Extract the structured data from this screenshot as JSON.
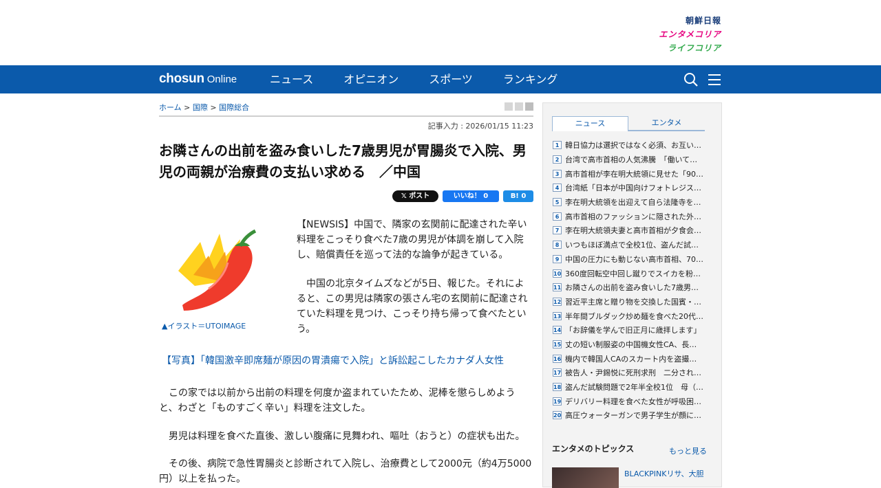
{
  "brand_links": [
    "朝鮮日報",
    "エンタメコリア",
    "ライフコリア"
  ],
  "nav": {
    "logo_bold": "chosun",
    "logo_light": "Online",
    "items": [
      "ニュース",
      "オピニオン",
      "スポーツ",
      "ランキング"
    ],
    "icons": [
      "search-icon",
      "menu-icon"
    ]
  },
  "breadcrumb": {
    "home": "ホーム",
    "sep": " > ",
    "cat1": "国際",
    "cat2": "国際総合"
  },
  "article": {
    "date": "記事入力 : 2026/01/15 11:23",
    "headline": "お隣さんの出前を盗み食いした7歳男児が胃腸炎で入院、男児の両親が治療費の支払い求める　／中国",
    "share": {
      "x": "𝕏 ポスト",
      "fb": "いいね！ 0",
      "hb": "B! 0"
    },
    "caption": "▲イラスト＝UTOIMAGE",
    "p1": "【NEWSIS】中国で、隣家の玄関前に配達された辛い料理をこっそり食べた7歳の男児が体調を崩して入院し、賠償責任を巡って法的な論争が起きている。",
    "p2": "　中国の北京タイムズなどが5日、報じた。それによると、この男児は隣家の張さん宅の玄関前に配達されていた料理を見つけ、こっそり持ち帰って食べたという。",
    "related": "【写真】「韓国激辛即席麺が原因の胃潰瘍で入院」と訴訟起こしたカナダ人女性",
    "p3": "　この家では以前から出前の料理を何度か盗まれていたため、泥棒を懲らしめようと、わざと「ものすごく辛い」料理を注文した。",
    "p4": "　男児は料理を食べた直後、激しい腹痛に見舞われ、嘔吐（おうと）の症状も出た。",
    "p5": "　その後、病院で急性胃腸炎と診断されて入院し、治療費として2000元（約4万5000円）以上を払った。"
  },
  "sidebar": {
    "tabs": [
      "ニュース",
      "エンタメ"
    ],
    "ranking": [
      "韓日協力は選択ではなく必須、お互い…",
      "台湾で高市首相の人気沸騰　「働いて…",
      "高市首相が李在明大統領に見せた「90…",
      "台湾紙「日本が中国向けフォトレジス…",
      "李在明大統領を出迎えて自ら法隆寺を…",
      "高市首相のファッションに隠された外…",
      "李在明大統領夫妻と高市首相が夕食会…",
      "いつもほぼ満点で全校1位、盗んだ試…",
      "中国の圧力にも動じない高市首相、70…",
      "360度回転空中回し蹴りでスイカを粉…",
      "お隣さんの出前を盗み食いした7歳男…",
      "習近平主席と贈り物を交換した国賓・…",
      "半年間ブルダック炒め麺を食べた20代…",
      "「お辞儀を学んで旧正月に歳拝します」",
      "丈の短い制服姿の中国機女性CA、長…",
      "機内で韓国人CAのスカート内を盗撮…",
      "被告人・尹錫悦に死刑求刑　二分され…",
      "盗んだ試験問題で2年半全校1位　母（…",
      "デリバリー料理を食べた女性が呼吸困…",
      "高圧ウォーターガンで男子学生が顔に…"
    ],
    "topics_title": "エンタメのトピックス",
    "more": "もっと見る",
    "topic_text": "BLACKPINKリサ、大胆"
  }
}
